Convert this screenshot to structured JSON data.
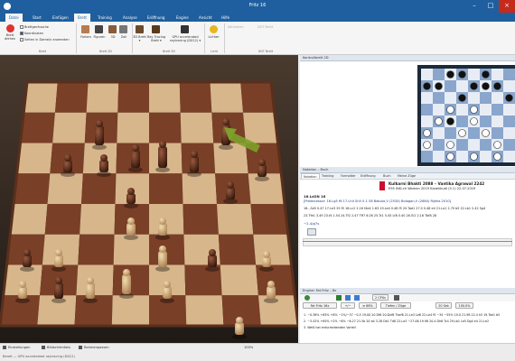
{
  "window": {
    "title": "Fritz 16"
  },
  "ribbon_tabs": [
    "Datei",
    "Start",
    "Einfügen",
    "Brett",
    "Training",
    "Analyse",
    "Eröffnung",
    "Engine",
    "Ansicht",
    "Hilfe"
  ],
  "ribbon": {
    "brett_rotate": "Brett drehen",
    "checks": [
      "Brettgeräusche",
      "Koordinaten",
      "Seiten in Dame/n anwenden"
    ],
    "icons": [
      "Farben",
      "Figuren",
      "3D",
      "Zoll"
    ],
    "icons2": [
      "3D Brett ▾",
      "Ray Tracing Brett ▾",
      "GPU accelerated raytracing (DX12) ▾",
      "Lichter"
    ],
    "groups": [
      "Brett",
      "Brett 2D",
      "Brett 3D",
      "Licht",
      "DGT Brett"
    ],
    "disabled": [
      "Aktivieren",
      "DGT Brett"
    ]
  },
  "panels": {
    "board2d": "Kontrollbrett 2D",
    "notation": "Notation – Buch",
    "engine": "Engine: Fat Fritz – 8x"
  },
  "notation_tabs": [
    "Notation",
    "Training",
    "Formatter",
    "Eröffnung",
    "Buch",
    "Meine Züge"
  ],
  "game": {
    "header": "Kulkarni Bhakti 2088 – Vantika Agrawal 2242",
    "subheader": "E95 IND-ch Women 2019 Karaikkudi (5.1) 22.07.2019",
    "line1": "16.Ld2N 16",
    "line2": "[Predecessor: 16.Lg5 f6 17.Lh4 Sh5 0-1 58 Babula,V (2534) Bologan,V (2684) Rijeka 2010]",
    "line3": "16...Se5 0.47 17.Le3 29 f5 18.Lc2 2.16 f4e4 1.63 19.Le4 0.48 f5 20.Tad1 27.0 0.48 e4 21.La1 2.70 b5 22.Lb1 2.42 Sg4",
    "line4": "23.Tfe1 3.49 23.f4 1.54 24.Tf2 2.47 Tff7 6:26 25.Tc1 5.45 Lf8 0.40 26.Tc2 2.16 Tbf8 28",
    "eval": "−2.4/g7s"
  },
  "engine": {
    "name": "Fat Fritz 16x",
    "buttons": [
      "+/−",
      "≡ 68%",
      "Tiefen / Züge",
      "2 CPUs",
      "20 Sek",
      "100.0%"
    ],
    "lines": [
      "1. −0.38% +65% +8% −1%/−37 −0.5 19.00 20 Df6 20.Dxf6 Tbxf6 21.Le3 Le6 22.Le4 f5 −34 −55% 19.0 21.98 22.4 h5 19.Tae1 b5",
      "2. −3.42% +65% +2% −6% −6.27 21.5b 20 b4 3.28 De1 Td8 22.La3 −27.06 19.98 20.4 Dh6 Tc4 29.Lb1 Le5 Dg4 e4 21.Le2",
      "3. Weiß hat entscheidenden Vorteil"
    ]
  },
  "status": {
    "settings": "Einstellungen",
    "screenshot": "Bildschirmfoto",
    "rotate": "Rahmenpassen",
    "zoom": "100%",
    "bottom": "Bereit — GPU accelerated raytracing (DX12)"
  },
  "colors": {
    "accent": "#1f5f9f",
    "board_light": "#d8b68c",
    "board_dark": "#7a3f27",
    "arrow": "#7da02a"
  }
}
